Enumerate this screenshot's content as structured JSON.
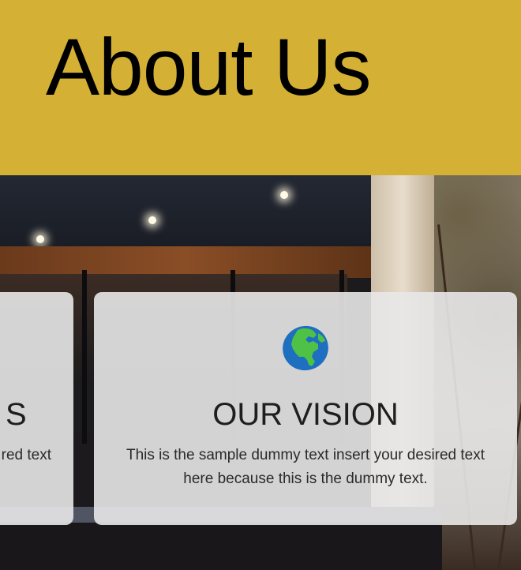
{
  "header": {
    "title": "About Us",
    "background_color": "#d4b035"
  },
  "cards": [
    {
      "title_fragment": "S",
      "text_fragment": "red text"
    },
    {
      "icon": "globe-americas-icon",
      "title": "OUR VISION",
      "text": "This is the sample dummy text insert your desired text here because this is the dummy text."
    }
  ]
}
